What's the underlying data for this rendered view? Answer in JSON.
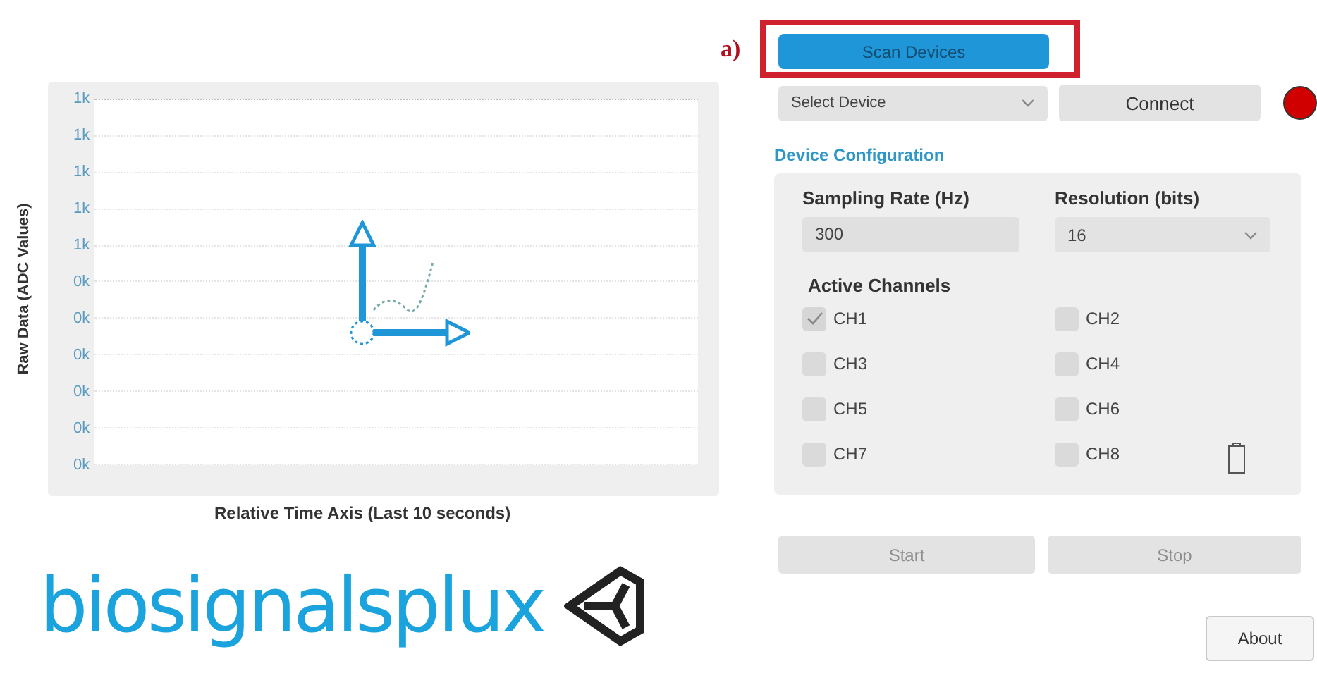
{
  "chart": {
    "ylabel": "Raw Data (ADC Values)",
    "xlabel": "Relative Time Axis (Last 10 seconds)",
    "ytick_labels": [
      "1k",
      "1k",
      "1k",
      "1k",
      "1k",
      "0k",
      "0k",
      "0k",
      "0k",
      "0k",
      "0k"
    ]
  },
  "logo": {
    "text": "biosignalsplux"
  },
  "annotation": {
    "label": "a)"
  },
  "scan_button": {
    "label": "Scan Devices"
  },
  "device_select": {
    "placeholder": "Select Device"
  },
  "connect_button": {
    "label": "Connect"
  },
  "connection_status": {
    "connected": false
  },
  "device_configuration": {
    "title": "Device Configuration",
    "sampling_rate": {
      "label": "Sampling Rate (Hz)",
      "value": "300"
    },
    "resolution": {
      "label": "Resolution (bits)",
      "value": "16"
    },
    "channels_title": "Active Channels",
    "channels": [
      {
        "label": "CH1",
        "checked": true
      },
      {
        "label": "CH2",
        "checked": false
      },
      {
        "label": "CH3",
        "checked": false
      },
      {
        "label": "CH4",
        "checked": false
      },
      {
        "label": "CH5",
        "checked": false
      },
      {
        "label": "CH6",
        "checked": false
      },
      {
        "label": "CH7",
        "checked": false
      },
      {
        "label": "CH8",
        "checked": false
      }
    ]
  },
  "start_button": {
    "label": "Start",
    "disabled": true
  },
  "stop_button": {
    "label": "Stop",
    "disabled": true
  },
  "about_button": {
    "label": "About"
  }
}
